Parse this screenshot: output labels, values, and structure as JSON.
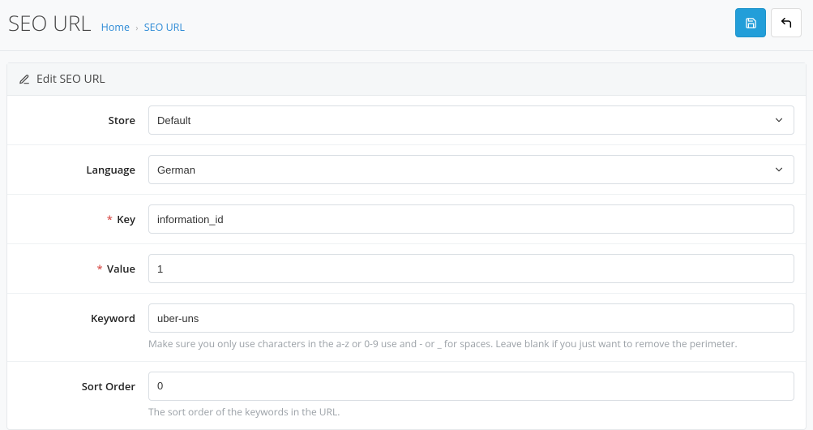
{
  "header": {
    "title": "SEO URL",
    "breadcrumb_home": "Home",
    "breadcrumb_current": "SEO URL"
  },
  "panel": {
    "title": "Edit SEO URL"
  },
  "form": {
    "store": {
      "label": "Store",
      "value": "Default"
    },
    "language": {
      "label": "Language",
      "value": "German"
    },
    "key": {
      "label": "Key",
      "value": "information_id"
    },
    "value": {
      "label": "Value",
      "value": "1"
    },
    "keyword": {
      "label": "Keyword",
      "value": "uber-uns",
      "help": "Make sure you only use characters in the a-z or 0-9 use and - or _ for spaces. Leave blank if you just want to remove the perimeter."
    },
    "sort_order": {
      "label": "Sort Order",
      "value": "0",
      "help": "The sort order of the keywords in the URL."
    }
  }
}
